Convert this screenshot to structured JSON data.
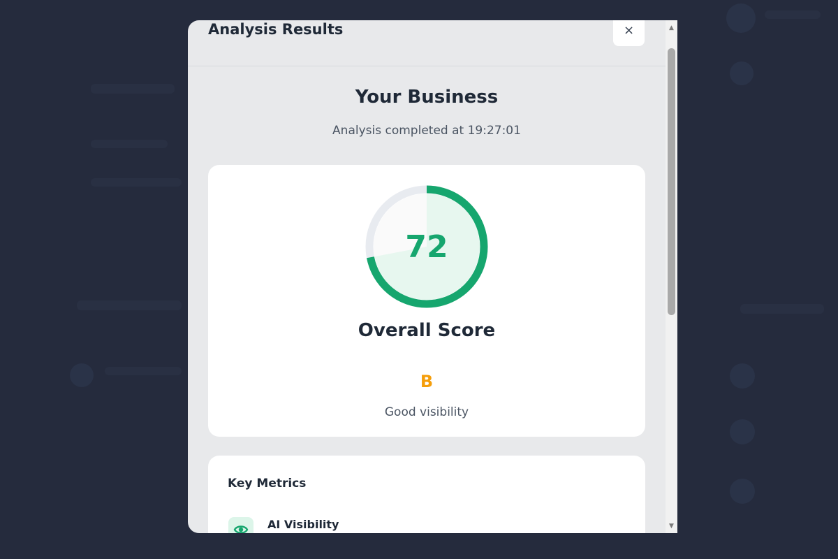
{
  "modal": {
    "title": "Analysis Results",
    "close_label": "×"
  },
  "business": {
    "name": "Your Business",
    "completed_text": "Analysis completed at 19:27:01"
  },
  "score": {
    "value": "72",
    "percent": 72,
    "label": "Overall Score",
    "grade": "B",
    "grade_description": "Good visibility"
  },
  "metrics": {
    "title": "Key Metrics",
    "items": [
      {
        "label": "AI Visibility",
        "icon": "eye-icon"
      }
    ]
  },
  "colors": {
    "accent": "#16a66e",
    "grade": "#f59e0b",
    "backdrop": "#252b3d"
  },
  "scrollbar": {
    "up": "▲",
    "down": "▼"
  }
}
